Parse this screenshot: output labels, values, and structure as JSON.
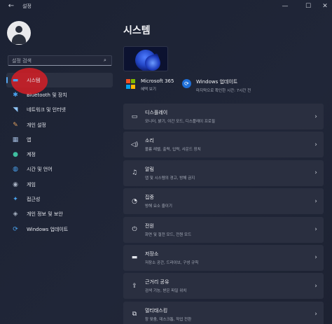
{
  "titlebar": {
    "title": "설정",
    "back_icon": "arrow-left-icon",
    "minimize": "—",
    "maximize": "☐",
    "close": "✕"
  },
  "search": {
    "placeholder": "설정 검색",
    "icon": "search-icon"
  },
  "sidebar": {
    "items": [
      {
        "label": "시스템",
        "icon": "display-icon",
        "glyph": "▬",
        "color": "#4aa3ef",
        "active": true
      },
      {
        "label": "Bluetooth 및 장치",
        "icon": "bluetooth-icon",
        "glyph": "✱",
        "color": "#4aa3ef"
      },
      {
        "label": "네트워크 및 인터넷",
        "icon": "wifi-icon",
        "glyph": "◥",
        "color": "#8fc4f6"
      },
      {
        "label": "개인 설정",
        "icon": "brush-icon",
        "glyph": "✎",
        "color": "#e0a060"
      },
      {
        "label": "앱",
        "icon": "apps-icon",
        "glyph": "▦",
        "color": "#9fb7d8"
      },
      {
        "label": "계정",
        "icon": "person-icon",
        "glyph": "●",
        "color": "#3fbfa0"
      },
      {
        "label": "시간 및 언어",
        "icon": "globe-clock-icon",
        "glyph": "◍",
        "color": "#4aa3ef"
      },
      {
        "label": "게임",
        "icon": "gamepad-icon",
        "glyph": "◉",
        "color": "#a9b3c4"
      },
      {
        "label": "접근성",
        "icon": "accessibility-icon",
        "glyph": "✦",
        "color": "#4aa3ef"
      },
      {
        "label": "개인 정보 및 보안",
        "icon": "shield-icon",
        "glyph": "◈",
        "color": "#a9b3c4"
      },
      {
        "label": "Windows 업데이트",
        "icon": "windows-update-icon",
        "glyph": "⟳",
        "color": "#4aa3ef"
      }
    ]
  },
  "main": {
    "title": "시스템",
    "microsoft365": {
      "title": "Microsoft 365",
      "sub": "혜택 보기"
    },
    "windows_update": {
      "title": "Windows 업데이트",
      "sub": "마지막으로 확인한 시간: 7시간 전"
    },
    "cards": [
      {
        "title": "디스플레이",
        "desc": "모니터, 밝기, 야간 모드, 디스플레이 프로필",
        "icon": "monitor-icon",
        "glyph": "▭"
      },
      {
        "title": "소리",
        "desc": "볼륨 레벨, 출력, 입력, 사운드 장치",
        "icon": "speaker-icon",
        "glyph": "🔈"
      },
      {
        "title": "알림",
        "desc": "앱 및 시스템의 경고, 방해 금지",
        "icon": "bell-icon",
        "glyph": "🔔"
      },
      {
        "title": "집중",
        "desc": "방해 요소 줄이기",
        "icon": "focus-icon",
        "glyph": "◔"
      },
      {
        "title": "전원",
        "desc": "화면 및 절전 모드, 전원 모드",
        "icon": "power-icon",
        "glyph": "⏻"
      },
      {
        "title": "저장소",
        "desc": "저장소 공간, 드라이브, 구성 규칙",
        "icon": "storage-icon",
        "glyph": "▬"
      },
      {
        "title": "근거리 공유",
        "desc": "검색 기능, 받은 파일 위치",
        "icon": "share-icon",
        "glyph": "⇪"
      },
      {
        "title": "멀티태스킹",
        "desc": "창 맞춤, 데스크톱, 작업 전환",
        "icon": "multitask-icon",
        "glyph": "⧉"
      }
    ],
    "chevron": "›"
  }
}
